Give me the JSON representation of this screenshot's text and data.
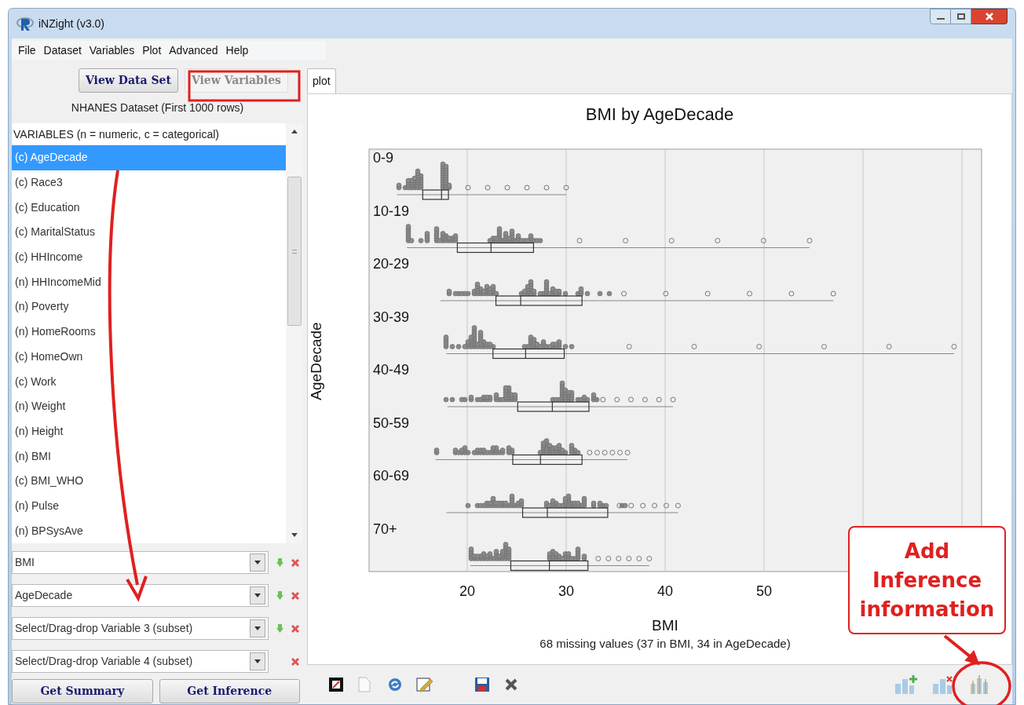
{
  "window": {
    "title": "iNZight (v3.0)"
  },
  "menu": [
    "File",
    "Dataset",
    "Variables",
    "Plot",
    "Advanced",
    "Help"
  ],
  "view_buttons": [
    {
      "label": "View Data Set",
      "disabled": false
    },
    {
      "label": "View Variables",
      "disabled": true
    }
  ],
  "dataset_label": "NHANES Dataset (First 1000 rows)",
  "variables": {
    "header": "VARIABLES (n = numeric, c = categorical)",
    "items": [
      {
        "label": "(c) AgeDecade",
        "selected": true
      },
      {
        "label": "(c) Race3",
        "selected": false
      },
      {
        "label": "(c) Education",
        "selected": false
      },
      {
        "label": "(c) MaritalStatus",
        "selected": false
      },
      {
        "label": "(c) HHIncome",
        "selected": false
      },
      {
        "label": "(n) HHIncomeMid",
        "selected": false
      },
      {
        "label": "(n) Poverty",
        "selected": false
      },
      {
        "label": "(n) HomeRooms",
        "selected": false
      },
      {
        "label": "(c) HomeOwn",
        "selected": false
      },
      {
        "label": "(c) Work",
        "selected": false
      },
      {
        "label": "(n) Weight",
        "selected": false
      },
      {
        "label": "(n) Height",
        "selected": false
      },
      {
        "label": "(n) BMI",
        "selected": false
      },
      {
        "label": "(c) BMI_WHO",
        "selected": false
      },
      {
        "label": "(n) Pulse",
        "selected": false
      },
      {
        "label": "(n) BPSysAve",
        "selected": false
      }
    ]
  },
  "variable_slots": [
    {
      "value": "BMI",
      "add_button": true
    },
    {
      "value": "AgeDecade",
      "add_button": true
    },
    {
      "value": "Select/Drag-drop Variable 3 (subset)",
      "add_button": true
    },
    {
      "value": "Select/Drag-drop Variable 4 (subset)",
      "add_button": false
    }
  ],
  "action_buttons": [
    "Get Summary",
    "Get Inference"
  ],
  "tabs": [
    {
      "label": "plot",
      "selected": true
    }
  ],
  "plot": {
    "title": "BMI by AgeDecade",
    "ylabel": "AgeDecade",
    "xlabel": "BMI",
    "group_labels": [
      "0-9",
      "10-19",
      "20-29",
      "30-39",
      "40-49",
      "50-59",
      "60-69",
      "70+"
    ],
    "xtick_labels": [
      "20",
      "30",
      "40",
      "50"
    ],
    "note": "68 missing values (37 in BMI, 34 in AgeDecade)"
  },
  "annotation": {
    "text": "Add Inference information"
  }
}
